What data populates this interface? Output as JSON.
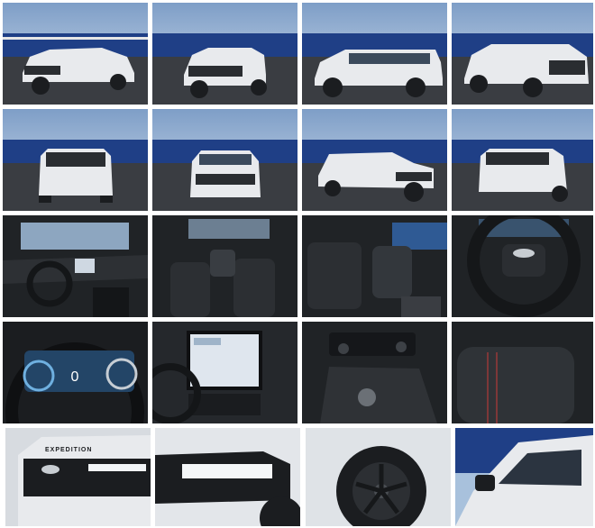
{
  "gallery": {
    "colors": {
      "sky_top": "#7e9ec7",
      "sky_bottom": "#c9d8ea",
      "ground": "#3a3d42",
      "container_blue": "#1f3f86",
      "vehicle_white": "#e8eaed",
      "interior_dark": "#202326",
      "trim_red": "#b23a3a"
    },
    "thumbnails": [
      {
        "icon": "exterior-front-3-4-icon"
      },
      {
        "icon": "exterior-front-3-4-icon"
      },
      {
        "icon": "exterior-side-profile-icon"
      },
      {
        "icon": "exterior-rear-3-4-icon"
      },
      {
        "icon": "exterior-rear-icon"
      },
      {
        "icon": "exterior-front-icon"
      },
      {
        "icon": "exterior-front-3-4-icon"
      },
      {
        "icon": "exterior-rear-3-4-icon"
      },
      {
        "icon": "interior-dashboard-icon"
      },
      {
        "icon": "interior-rear-seats-icon"
      },
      {
        "icon": "interior-second-row-icon"
      },
      {
        "icon": "steering-wheel-icon"
      },
      {
        "icon": "instrument-cluster-icon"
      },
      {
        "icon": "touchscreen-icon"
      },
      {
        "icon": "center-console-icon"
      },
      {
        "icon": "seat-detail-icon"
      },
      {
        "icon": "grille-detail-icon"
      },
      {
        "icon": "headlamp-detail-icon"
      },
      {
        "icon": "wheel-detail-icon"
      },
      {
        "icon": "mirror-detail-icon"
      }
    ],
    "badge_text": "EXPEDITION",
    "cluster_speed": "0"
  }
}
